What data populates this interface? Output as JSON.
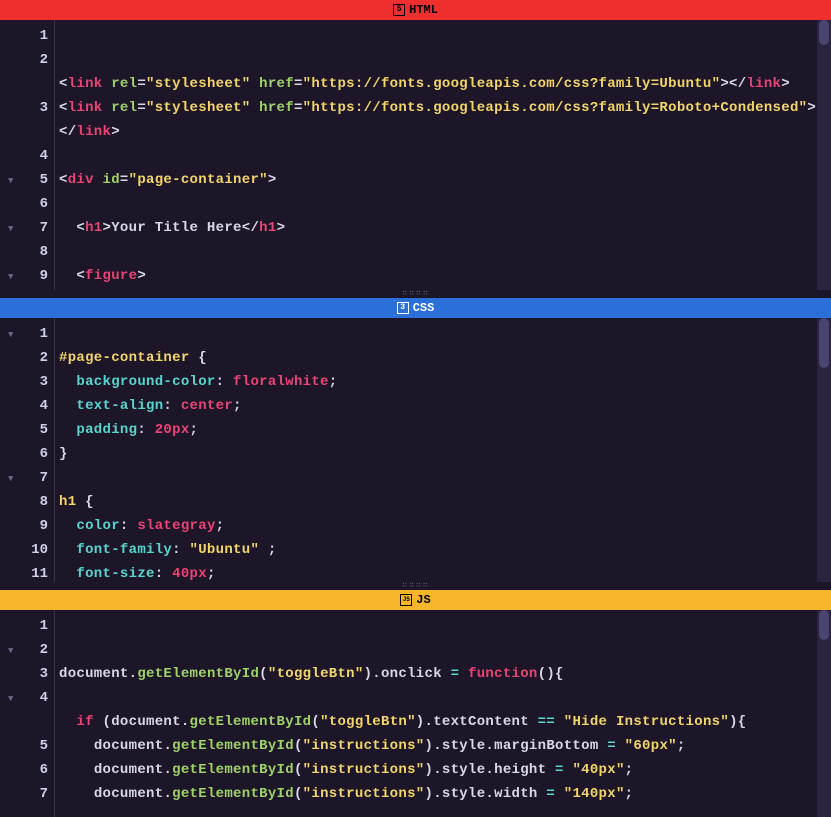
{
  "panels": {
    "html": {
      "label": "HTML",
      "badge": "5"
    },
    "css": {
      "label": "CSS",
      "badge": "3"
    },
    "js": {
      "label": "JS",
      "badge": "JS"
    }
  },
  "html_code": {
    "line1": "",
    "line2_url": "https://fonts.googleapis.com/css?family=Ubuntu",
    "line3_url": "https://fonts.googleapis.com/css?family=Roboto+Condensed",
    "link_rel": "stylesheet",
    "tag_link": "link",
    "attr_rel": "rel",
    "attr_href": "href",
    "tag_div": "div",
    "attr_id": "id",
    "div_id": "page-container",
    "tag_h1": "h1",
    "h1_text": "Your Title Here",
    "tag_figure": "figure"
  },
  "css_code": {
    "sel1": "#page-container",
    "props1": [
      {
        "p": "background-color",
        "v": "floralwhite"
      },
      {
        "p": "text-align",
        "v": "center"
      },
      {
        "p": "padding",
        "v": "20px"
      }
    ],
    "sel2": "h1",
    "props2": [
      {
        "p": "color",
        "v": "slategray"
      },
      {
        "p": "font-family",
        "v": "\"Ubuntu\" "
      },
      {
        "p": "font-size",
        "v": "40px"
      }
    ]
  },
  "js_code": {
    "obj_document": "document",
    "m_getElementById": "getElementById",
    "id_toggleBtn": "toggleBtn",
    "id_instructions": "instructions",
    "prop_onclick": "onclick",
    "kw_function": "function",
    "kw_if": "if",
    "prop_textContent": "textContent",
    "val_hide": "Hide Instructions",
    "prop_style": "style",
    "prop_marginBottom": "marginBottom",
    "prop_height": "height",
    "prop_width": "width",
    "val_60px": "60px",
    "val_40px": "40px",
    "val_140px": "140px"
  },
  "gutters": {
    "html": [
      {
        "n": "1",
        "fold": false
      },
      {
        "n": "2",
        "fold": false
      },
      {
        "n": "",
        "fold": false
      },
      {
        "n": "3",
        "fold": false
      },
      {
        "n": "",
        "fold": false
      },
      {
        "n": "4",
        "fold": false
      },
      {
        "n": "5",
        "fold": true
      },
      {
        "n": "6",
        "fold": false
      },
      {
        "n": "7",
        "fold": true
      },
      {
        "n": "8",
        "fold": false
      },
      {
        "n": "9",
        "fold": true
      }
    ],
    "css": [
      {
        "n": "1",
        "fold": true
      },
      {
        "n": "2",
        "fold": false
      },
      {
        "n": "3",
        "fold": false
      },
      {
        "n": "4",
        "fold": false
      },
      {
        "n": "5",
        "fold": false
      },
      {
        "n": "6",
        "fold": false
      },
      {
        "n": "7",
        "fold": true
      },
      {
        "n": "8",
        "fold": false
      },
      {
        "n": "9",
        "fold": false
      },
      {
        "n": "10",
        "fold": false
      },
      {
        "n": "11",
        "fold": false
      }
    ],
    "js": [
      {
        "n": "1",
        "fold": false
      },
      {
        "n": "2",
        "fold": true
      },
      {
        "n": "3",
        "fold": false
      },
      {
        "n": "4",
        "fold": true
      },
      {
        "n": "",
        "fold": false
      },
      {
        "n": "5",
        "fold": false
      },
      {
        "n": "6",
        "fold": false
      },
      {
        "n": "7",
        "fold": false
      }
    ]
  }
}
